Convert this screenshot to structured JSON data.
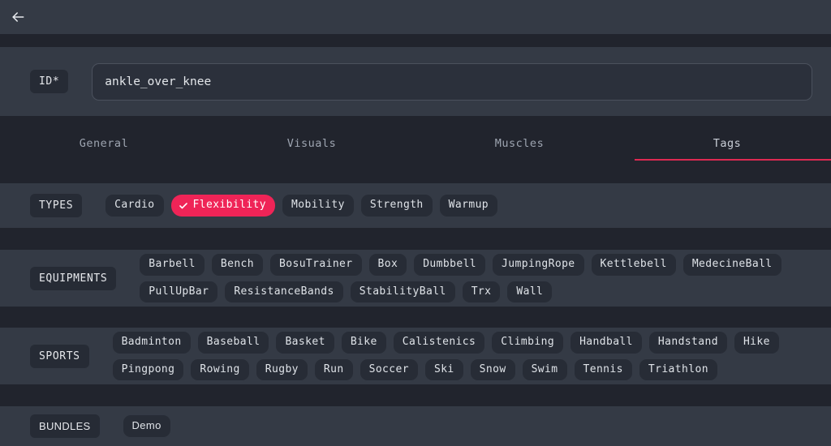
{
  "header": {
    "back_icon": "arrow-left-icon"
  },
  "id_row": {
    "label": "ID*",
    "value": "ankle_over_knee",
    "placeholder": "ID"
  },
  "tabs": [
    {
      "label": "General",
      "active": false
    },
    {
      "label": "Visuals",
      "active": false
    },
    {
      "label": "Muscles",
      "active": false
    },
    {
      "label": "Tags",
      "active": true
    }
  ],
  "sections": {
    "types": {
      "label": "TYPES",
      "chips": [
        {
          "label": "Cardio",
          "selected": false
        },
        {
          "label": "Flexibility",
          "selected": true
        },
        {
          "label": "Mobility",
          "selected": false
        },
        {
          "label": "Strength",
          "selected": false
        },
        {
          "label": "Warmup",
          "selected": false
        }
      ]
    },
    "equipments": {
      "label": "EQUIPMENTS",
      "chips": [
        {
          "label": "Barbell",
          "selected": false
        },
        {
          "label": "Bench",
          "selected": false
        },
        {
          "label": "BosuTrainer",
          "selected": false
        },
        {
          "label": "Box",
          "selected": false
        },
        {
          "label": "Dumbbell",
          "selected": false
        },
        {
          "label": "JumpingRope",
          "selected": false
        },
        {
          "label": "Kettlebell",
          "selected": false
        },
        {
          "label": "MedecineBall",
          "selected": false
        },
        {
          "label": "PullUpBar",
          "selected": false
        },
        {
          "label": "ResistanceBands",
          "selected": false
        },
        {
          "label": "StabilityBall",
          "selected": false
        },
        {
          "label": "Trx",
          "selected": false
        },
        {
          "label": "Wall",
          "selected": false
        }
      ]
    },
    "sports": {
      "label": "SPORTS",
      "chips": [
        {
          "label": "Badminton",
          "selected": false
        },
        {
          "label": "Baseball",
          "selected": false
        },
        {
          "label": "Basket",
          "selected": false
        },
        {
          "label": "Bike",
          "selected": false
        },
        {
          "label": "Calistenics",
          "selected": false
        },
        {
          "label": "Climbing",
          "selected": false
        },
        {
          "label": "Handball",
          "selected": false
        },
        {
          "label": "Handstand",
          "selected": false
        },
        {
          "label": "Hike",
          "selected": false
        },
        {
          "label": "Pingpong",
          "selected": false
        },
        {
          "label": "Rowing",
          "selected": false
        },
        {
          "label": "Rugby",
          "selected": false
        },
        {
          "label": "Run",
          "selected": false
        },
        {
          "label": "Soccer",
          "selected": false
        },
        {
          "label": "Ski",
          "selected": false
        },
        {
          "label": "Snow",
          "selected": false
        },
        {
          "label": "Swim",
          "selected": false
        },
        {
          "label": "Tennis",
          "selected": false
        },
        {
          "label": "Triathlon",
          "selected": false
        }
      ]
    },
    "bundles": {
      "label": "BUNDLES",
      "chips": [
        {
          "label": "Demo",
          "selected": false
        }
      ]
    }
  },
  "colors": {
    "accent": "#ef2457",
    "tab_underline": "#de2a52",
    "band_bg": "#343a45",
    "gap_bg": "#21242d",
    "chip_bg": "#272c36",
    "badge_bg": "#262b35"
  }
}
